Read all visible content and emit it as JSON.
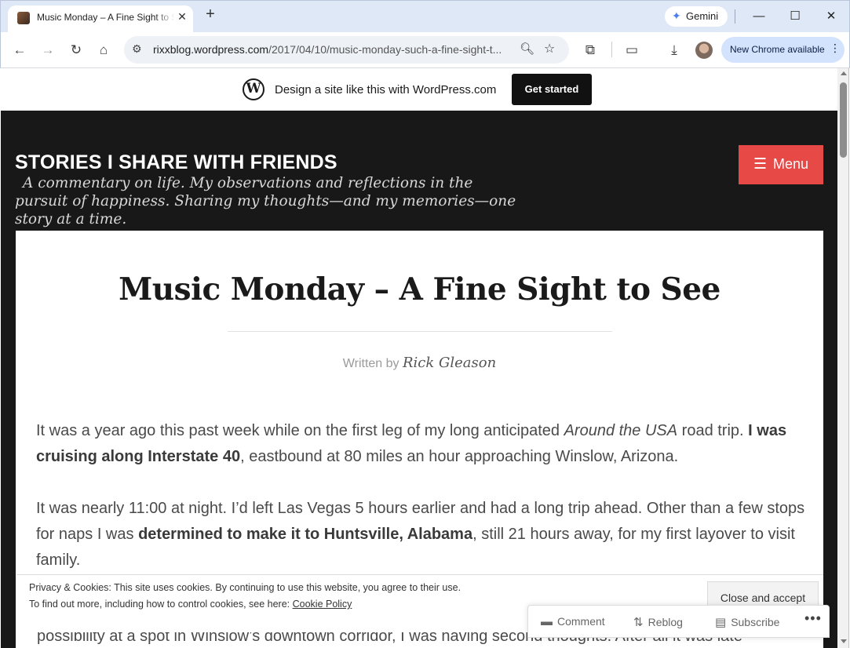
{
  "browser": {
    "tab_title": "Music Monday – A Fine Sight to See",
    "tab_close": "✕",
    "new_tab": "+",
    "gemini_label": "Gemini",
    "window_minimize": "—",
    "window_maximize": "☐",
    "window_close": "✕",
    "url_host": "rixxblog.wordpress.com",
    "url_path": "/2017/04/10/music-monday-such-a-fine-sight-t...",
    "update_label": "New Chrome available",
    "icons": [
      "back-icon",
      "forward-icon",
      "reload-icon",
      "home-icon",
      "site-info-icon",
      "zoom-icon",
      "bookmark-star-icon",
      "extensions-icon",
      "tab-search-icon",
      "downloads-icon",
      "profile-avatar",
      "more-icon"
    ]
  },
  "wpbar": {
    "text": "Design a site like this with WordPress.com",
    "cta": "Get started",
    "logo_letter": "W"
  },
  "site": {
    "title": "STORIES I SHARE WITH FRIENDS",
    "description": "A commentary on life. My observations and reflections in the pursuit of happiness. Sharing my thoughts—and my memories—one story at a time.",
    "menu_label": "Menu"
  },
  "post": {
    "title": "Music Monday – A Fine Sight to See",
    "byline_prefix": "Written by",
    "author": "Rick Gleason",
    "p1_a": "It was a year ago this past week while on the first leg of my long anticipated ",
    "p1_em": "Around the USA",
    "p1_b": " road trip. ",
    "p1_strong": "I was cruising along Interstate 40",
    "p1_c": ", eastbound at 80 miles an hour approaching Winslow, Arizona.",
    "p2_a": "It was nearly 11:00 at night. I’d left Las Vegas 5 hours earlier and had a long trip ahead. Other than a few stops for naps I was ",
    "p2_strong": "determined to make it to Huntsville, Alabama",
    "p2_b": ", still 21 hours away, for my first layover to visit family.",
    "cutoff_line": "possibility at a spot in Winslow’s downtown corridor, I was having second thoughts. After all it was late"
  },
  "cookie": {
    "line1": "Privacy & Cookies: This site uses cookies. By continuing to use this website, you agree to their use.",
    "line2": "To find out more, including how to control cookies, see here: ",
    "link": "Cookie Policy",
    "accept": "Close and accept"
  },
  "actions": {
    "comment": "Comment",
    "reblog": "Reblog",
    "subscribe": "Subscribe",
    "more": "•••"
  },
  "colors": {
    "header_bg": "#181818",
    "menu_button": "#e64946",
    "tabbar_bg": "#dfe8f7",
    "update_pill": "#d3e3fd"
  }
}
